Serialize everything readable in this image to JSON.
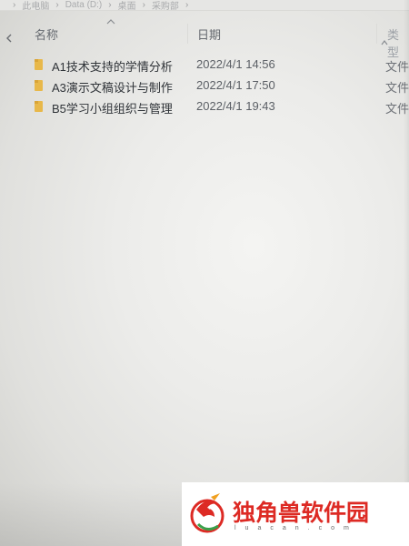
{
  "breadcrumb": {
    "items": [
      "此电脑",
      "Data (D:)",
      "桌面",
      "采购部"
    ]
  },
  "columns": {
    "name": "名称",
    "date": "日期",
    "type": "类型"
  },
  "files": [
    {
      "name": "A1技术支持的学情分析",
      "date": "2022/4/1 14:56",
      "type": "文件",
      "icon": "folder-icon"
    },
    {
      "name": "A3演示文稿设计与制作",
      "date": "2022/4/1 17:50",
      "type": "文件",
      "icon": "folder-icon"
    },
    {
      "name": "B5学习小组组织与管理",
      "date": "2022/4/1 19:43",
      "type": "文件",
      "icon": "folder-icon"
    }
  ],
  "colors": {
    "folder": "#e8b84a",
    "watermark_red": "#dd2a24"
  },
  "watermark": {
    "title": "独角兽软件园",
    "subtitle": "luacan.com"
  }
}
